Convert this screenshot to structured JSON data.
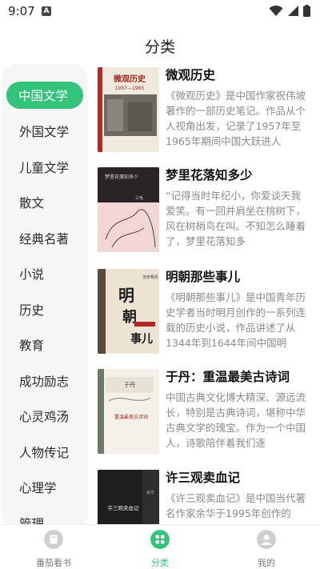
{
  "status": {
    "time": "9:07",
    "notif_letter": "A"
  },
  "header": {
    "title": "分类"
  },
  "sidebar": {
    "items": [
      {
        "label": "中国文学",
        "active": true
      },
      {
        "label": "外国文学"
      },
      {
        "label": "儿童文学"
      },
      {
        "label": "散文"
      },
      {
        "label": "经典名著"
      },
      {
        "label": "小说"
      },
      {
        "label": "历史"
      },
      {
        "label": "教育"
      },
      {
        "label": "成功励志"
      },
      {
        "label": "心灵鸡汤"
      },
      {
        "label": "人物传记"
      },
      {
        "label": "心理学"
      },
      {
        "label": "管理"
      }
    ]
  },
  "books": [
    {
      "title": "微观历史",
      "desc": "《微观历史》是中国作家祝伟坡著作的一部历史笔记。作品从个人视角出发，记录了1957年至1965年期间中国大跃进人",
      "cover_text": "微观历史",
      "cover_sub": "1957—1965"
    },
    {
      "title": "梦里花落知多少",
      "desc": "“记得当时年纪小，你爱谈天我爱笑。有一回并肩坐在桃树下，风在树梢鸟在叫。不知怎么睡着了，梦里花落知多",
      "cover_text": "梦里花落知多少",
      "cover_sub": "三毛"
    },
    {
      "title": "明朝那些事儿",
      "desc": "《明朝那些事儿》是中国青年历史学者当时明月创作的一系列连载的历史小说，作品讲述了从1344年到1644年间中国明",
      "cover_text": "明朝那些事儿",
      "cover_sub": "当年明月"
    },
    {
      "title": "于丹：重温最美古诗词",
      "desc": "中国古典文化博大精深、源远流长，特别是古典诗词，堪称中华古典文学的瑰宝。作为一个中国人，诗歌陪伴着我们逐",
      "cover_text": "重温最美古诗词",
      "cover_sub": "于丹"
    },
    {
      "title": "许三观卖血记",
      "desc": "《许三观卖血记》是中国当代著名作家余华于1995年创作的",
      "cover_text": "许三观卖血记",
      "cover_sub": "余华"
    }
  ],
  "tabbar": {
    "items": [
      {
        "label": "番茄看书"
      },
      {
        "label": "分类",
        "active": true
      },
      {
        "label": "我的"
      }
    ]
  },
  "colors": {
    "accent": "#33c37a"
  }
}
